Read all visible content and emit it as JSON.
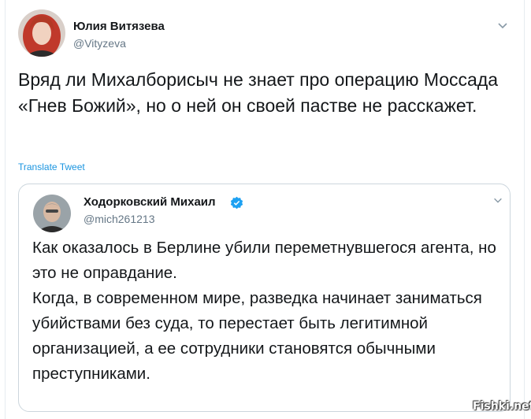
{
  "author": {
    "name": "Юлия Витязева",
    "handle": "@Vityzeva"
  },
  "tweet": {
    "text": "Вряд ли Михалборисыч не знает про операцию Моссада «Гнев Божий», но о ней он своей пастве не расскажет.",
    "translate_label": "Translate Tweet"
  },
  "quoted": {
    "name": "Ходорковский Михаил",
    "handle": "@mich261213",
    "paragraphs": [
      "Как оказалось в Берлине убили переметнувшегося агента, но это не оправдание.",
      "Когда, в современном мире, разведка начинает заниматься убийствами без суда, то перестает быть легитимной организацией, а ее сотрудники становятся обычными преступниками."
    ]
  },
  "watermark": "Fishki.net",
  "icons": {
    "menu": "chevron-down-icon",
    "verified": "verified-badge-icon"
  },
  "colors": {
    "link": "#1b95e0",
    "muted": "#657786",
    "verified": "#1da1f2"
  }
}
